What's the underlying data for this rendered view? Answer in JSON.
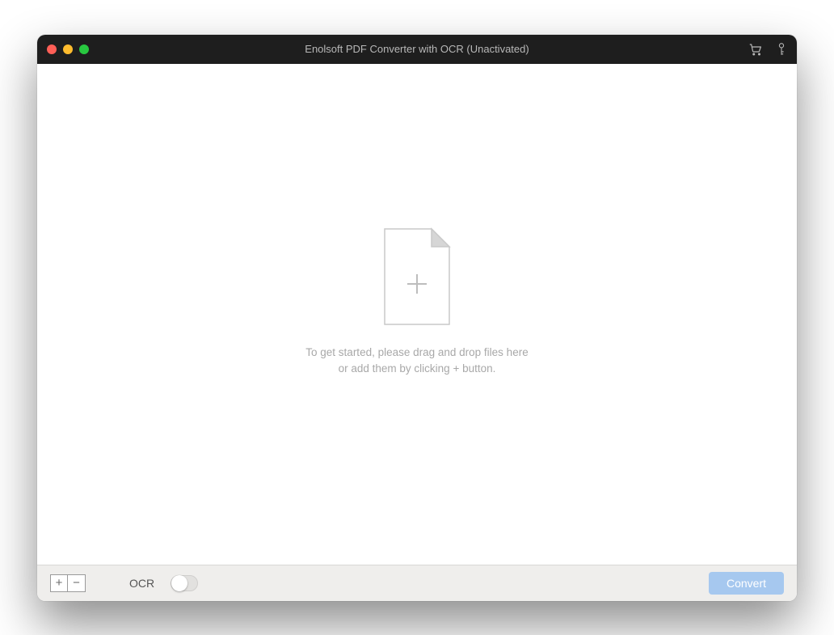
{
  "titlebar": {
    "title": "Enolsoft PDF Converter with OCR (Unactivated)"
  },
  "dropzone": {
    "line1": "To get started, please drag and drop files here",
    "line2": "or add them by clicking + button."
  },
  "toolbar": {
    "add_label": "+",
    "remove_label": "−",
    "ocr_label": "OCR",
    "ocr_enabled": false,
    "convert_label": "Convert"
  }
}
